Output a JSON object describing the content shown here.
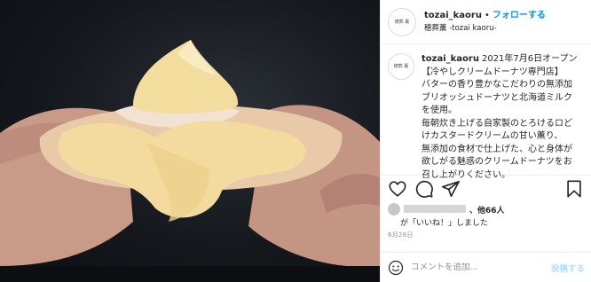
{
  "post": {
    "username": "tozai_kaoru",
    "separator": "•",
    "follow_label": "フォローする",
    "subname": "穂葬薫 -tozai kaoru-",
    "avatar_text": "穂葬 薫"
  },
  "caption": {
    "username": "tozai_kaoru",
    "date_text": "2021年7月6日オープン",
    "lines": [
      "【冷やしクリームドーナツ専門店】",
      "バターの香り豊かなこだわりの無添加",
      "ブリオッシュドーナツと北海道ミルク",
      "を使用。",
      "毎朝炊き上げる自家製のとろけるロど",
      "けカスタードクリームの甘い薫り、",
      "無添加の食材で仕上げた、心と身体が",
      "欲しがる魅惑のクリームドーナツをお",
      "召し上がりください。"
    ]
  },
  "likes": {
    "others": "、他66人",
    "suffix": "が「いいね！」しました"
  },
  "post_date": "6月26日",
  "comment": {
    "placeholder": "コメントを追加...",
    "post_label": "投稿する"
  },
  "colors": {
    "follow_blue": "#0095f6",
    "post_button_disabled": "#b2dffc",
    "text": "#262626",
    "secondary_text": "#8e8e8e"
  },
  "icons": [
    "heart-icon",
    "comment-icon",
    "share-icon",
    "bookmark-icon",
    "emoji-icon"
  ]
}
